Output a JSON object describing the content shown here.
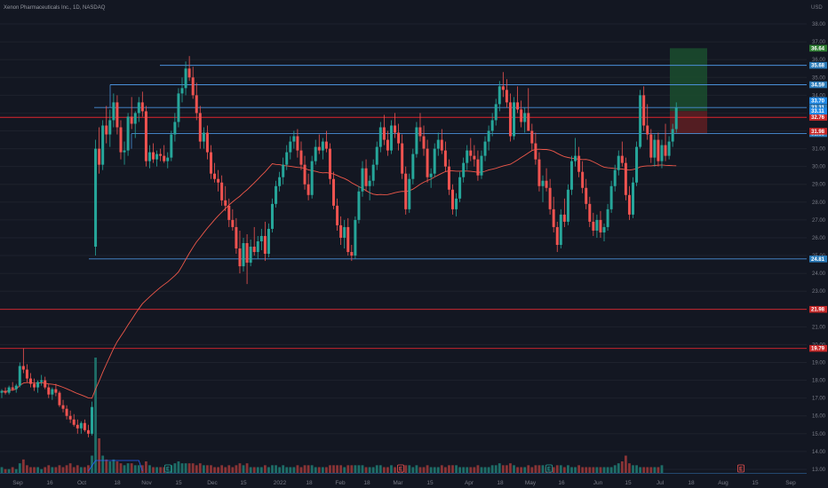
{
  "title": "Xenon Pharmaceuticals Inc., 1D, NASDAQ",
  "currency": "USD",
  "colors": {
    "background": "#131722",
    "up": "#26a69a",
    "down": "#ef5350",
    "blue_line": "#2962ff",
    "light_blue": "#4a90d9",
    "red_line": "#e0262e",
    "ma": "#f0584a",
    "profit_zone": "#1b4d2e",
    "loss_zone": "#5b1e22",
    "axis_text": "#787b86"
  },
  "chart_data": {
    "type": "candlestick",
    "y_axis": {
      "ylim": [
        12.6,
        38.6
      ],
      "ticks": [
        "13.00",
        "14.00",
        "15.00",
        "16.00",
        "17.00",
        "18.00",
        "19.00",
        "20.00",
        "21.00",
        "22.00",
        "23.00",
        "24.00",
        "25.00",
        "26.00",
        "27.00",
        "28.00",
        "29.00",
        "30.00",
        "31.00",
        "32.00",
        "33.00",
        "34.00",
        "35.00",
        "36.00",
        "37.00",
        "38.00"
      ]
    },
    "x_axis": {
      "labels": [
        "Sep",
        "16",
        "Oct",
        "18",
        "Nov",
        "15",
        "Dec",
        "15",
        "2022",
        "18",
        "Feb",
        "18",
        "Mar",
        "15",
        "Apr",
        "18",
        "May",
        "16",
        "Jun",
        "15",
        "Jul",
        "18",
        "Aug",
        "15",
        "Sep"
      ]
    },
    "horizontal_levels": [
      {
        "name": "level-35-68",
        "value": 35.68,
        "color": "light_blue",
        "label": "35.68"
      },
      {
        "name": "level-34-59",
        "value": 34.59,
        "color": "light_blue",
        "label": "34.59"
      },
      {
        "name": "level-33-31",
        "value": 33.31,
        "color": "light_blue",
        "label": "33.31"
      },
      {
        "name": "level-31-85",
        "value": 31.85,
        "color": "light_blue",
        "label": "31.85"
      },
      {
        "name": "level-24-81",
        "value": 24.81,
        "color": "light_blue",
        "label": "24.81"
      },
      {
        "name": "level-32-76",
        "value": 32.76,
        "color": "red_line",
        "label": "32.76"
      },
      {
        "name": "level-21-98",
        "value": 21.98,
        "color": "red_line",
        "label": "21.98"
      },
      {
        "name": "level-19-79",
        "value": 19.79,
        "color": "red_line",
        "label": "19.79"
      }
    ],
    "price_badges": [
      {
        "value": 36.64,
        "label": "36.64",
        "bg": "#2e7d32"
      },
      {
        "value": 33.7,
        "label": "33.70",
        "bg": "#1e88e5"
      },
      {
        "value": 33.11,
        "label": "33.11",
        "bg": "#1e88e5"
      },
      {
        "value": 31.98,
        "label": "31.98",
        "bg": "#c62828"
      }
    ],
    "position": {
      "entry": 33.11,
      "target": 36.64,
      "stop": 31.85
    },
    "candles": [
      [
        17.3,
        17.5,
        17.0,
        17.4
      ],
      [
        17.4,
        17.6,
        17.2,
        17.3
      ],
      [
        17.3,
        17.7,
        17.2,
        17.6
      ],
      [
        17.6,
        17.9,
        17.4,
        17.5
      ],
      [
        17.5,
        17.8,
        17.3,
        17.7
      ],
      [
        17.7,
        19.0,
        17.6,
        18.8
      ],
      [
        18.8,
        19.8,
        18.4,
        18.6
      ],
      [
        18.6,
        18.9,
        17.9,
        18.1
      ],
      [
        18.1,
        18.4,
        17.6,
        17.8
      ],
      [
        17.8,
        18.1,
        17.4,
        17.6
      ],
      [
        17.6,
        18.0,
        17.3,
        17.9
      ],
      [
        17.9,
        18.3,
        17.7,
        18.0
      ],
      [
        18.0,
        18.2,
        17.5,
        17.6
      ],
      [
        17.6,
        17.8,
        17.0,
        17.2
      ],
      [
        17.2,
        17.6,
        16.9,
        17.5
      ],
      [
        17.5,
        17.8,
        17.1,
        17.3
      ],
      [
        17.3,
        17.4,
        16.5,
        16.6
      ],
      [
        16.6,
        16.9,
        16.2,
        16.4
      ],
      [
        16.4,
        16.6,
        15.8,
        16.0
      ],
      [
        16.0,
        16.3,
        15.6,
        15.8
      ],
      [
        15.8,
        16.1,
        15.4,
        15.5
      ],
      [
        15.5,
        15.8,
        15.0,
        15.3
      ],
      [
        15.3,
        15.7,
        15.0,
        15.6
      ],
      [
        15.6,
        15.8,
        15.1,
        15.2
      ],
      [
        15.2,
        15.5,
        14.8,
        15.0
      ],
      [
        15.0,
        16.8,
        14.9,
        16.5
      ],
      [
        25.5,
        31.5,
        25.0,
        31.0
      ],
      [
        31.0,
        32.2,
        29.6,
        30.1
      ],
      [
        30.1,
        32.6,
        29.8,
        32.3
      ],
      [
        32.3,
        33.4,
        31.3,
        31.8
      ],
      [
        31.8,
        33.2,
        31.1,
        32.6
      ],
      [
        32.6,
        34.1,
        32.2,
        33.6
      ],
      [
        33.6,
        34.0,
        31.8,
        32.2
      ],
      [
        32.2,
        32.6,
        30.4,
        30.8
      ],
      [
        30.8,
        31.4,
        30.1,
        30.9
      ],
      [
        30.9,
        33.0,
        30.6,
        32.8
      ],
      [
        32.8,
        33.9,
        32.1,
        32.4
      ],
      [
        32.4,
        33.1,
        31.6,
        33.0
      ],
      [
        33.0,
        33.9,
        32.5,
        33.6
      ],
      [
        33.6,
        34.2,
        32.8,
        33.1
      ],
      [
        33.1,
        33.4,
        30.0,
        30.3
      ],
      [
        30.3,
        31.2,
        29.9,
        30.8
      ],
      [
        30.8,
        31.3,
        30.2,
        30.4
      ],
      [
        30.4,
        30.9,
        30.0,
        30.7
      ],
      [
        30.7,
        31.0,
        30.3,
        30.6
      ],
      [
        30.6,
        31.2,
        30.2,
        30.3
      ],
      [
        30.3,
        30.8,
        29.9,
        30.5
      ],
      [
        30.5,
        32.0,
        30.3,
        31.8
      ],
      [
        31.8,
        33.0,
        31.4,
        32.5
      ],
      [
        32.5,
        34.4,
        32.2,
        34.1
      ],
      [
        34.1,
        35.0,
        33.6,
        34.4
      ],
      [
        34.4,
        35.9,
        34.0,
        35.5
      ],
      [
        35.5,
        36.2,
        34.8,
        35.0
      ],
      [
        35.0,
        35.6,
        33.8,
        34.0
      ],
      [
        34.0,
        34.7,
        32.6,
        33.0
      ],
      [
        33.0,
        33.4,
        31.0,
        31.4
      ],
      [
        31.4,
        32.2,
        31.0,
        31.9
      ],
      [
        31.9,
        32.3,
        30.4,
        30.8
      ],
      [
        30.8,
        31.2,
        29.3,
        29.6
      ],
      [
        29.6,
        30.2,
        29.1,
        29.3
      ],
      [
        29.3,
        29.8,
        28.6,
        29.1
      ],
      [
        29.1,
        29.5,
        27.8,
        28.1
      ],
      [
        28.1,
        28.9,
        27.5,
        27.8
      ],
      [
        27.8,
        28.2,
        26.6,
        27.0
      ],
      [
        27.0,
        27.6,
        26.4,
        26.6
      ],
      [
        26.6,
        27.1,
        25.1,
        25.4
      ],
      [
        25.4,
        26.4,
        24.0,
        24.4
      ],
      [
        24.4,
        26.0,
        24.1,
        25.7
      ],
      [
        25.7,
        26.2,
        23.4,
        24.6
      ],
      [
        24.6,
        25.9,
        24.4,
        25.5
      ],
      [
        25.5,
        26.6,
        25.0,
        25.2
      ],
      [
        25.2,
        26.1,
        24.8,
        25.8
      ],
      [
        25.8,
        26.5,
        25.3,
        26.1
      ],
      [
        26.1,
        26.9,
        24.7,
        25.1
      ],
      [
        25.1,
        26.8,
        24.9,
        26.5
      ],
      [
        26.5,
        28.2,
        26.3,
        27.9
      ],
      [
        27.9,
        29.2,
        27.7,
        28.9
      ],
      [
        28.9,
        29.7,
        28.6,
        29.4
      ],
      [
        29.4,
        30.5,
        29.0,
        30.1
      ],
      [
        30.1,
        31.2,
        29.8,
        30.8
      ],
      [
        30.8,
        31.7,
        30.4,
        31.4
      ],
      [
        31.4,
        32.0,
        31.0,
        31.7
      ],
      [
        31.7,
        32.1,
        30.5,
        30.9
      ],
      [
        30.9,
        31.4,
        29.8,
        30.1
      ],
      [
        30.1,
        30.6,
        28.7,
        29.0
      ],
      [
        29.0,
        29.6,
        28.1,
        28.4
      ],
      [
        28.4,
        30.6,
        28.2,
        30.3
      ],
      [
        30.3,
        31.5,
        30.1,
        31.1
      ],
      [
        31.1,
        31.8,
        30.7,
        30.9
      ],
      [
        30.9,
        31.6,
        30.4,
        31.4
      ],
      [
        31.4,
        32.0,
        30.8,
        31.0
      ],
      [
        31.0,
        31.3,
        29.0,
        29.3
      ],
      [
        29.3,
        29.7,
        27.6,
        27.8
      ],
      [
        27.8,
        28.2,
        26.4,
        26.7
      ],
      [
        26.7,
        27.2,
        25.6,
        26.0
      ],
      [
        26.0,
        27.0,
        25.4,
        26.6
      ],
      [
        26.6,
        27.1,
        25.0,
        25.2
      ],
      [
        25.2,
        25.6,
        24.7,
        25.0
      ],
      [
        25.0,
        27.2,
        24.8,
        27.0
      ],
      [
        27.0,
        28.9,
        26.8,
        28.6
      ],
      [
        28.6,
        30.3,
        28.3,
        29.9
      ],
      [
        29.9,
        30.4,
        28.6,
        28.9
      ],
      [
        28.9,
        29.5,
        28.1,
        29.2
      ],
      [
        29.2,
        30.4,
        28.9,
        30.1
      ],
      [
        30.1,
        31.4,
        29.8,
        31.1
      ],
      [
        31.1,
        32.5,
        30.8,
        32.2
      ],
      [
        32.2,
        32.9,
        31.2,
        31.5
      ],
      [
        31.5,
        32.0,
        30.6,
        30.9
      ],
      [
        30.9,
        32.6,
        30.7,
        32.3
      ],
      [
        32.3,
        33.0,
        31.6,
        31.9
      ],
      [
        31.9,
        32.4,
        30.9,
        31.3
      ],
      [
        31.3,
        31.8,
        29.3,
        29.6
      ],
      [
        29.6,
        30.0,
        27.3,
        27.6
      ],
      [
        27.6,
        29.6,
        27.4,
        29.3
      ],
      [
        29.3,
        31.0,
        29.0,
        30.7
      ],
      [
        30.7,
        32.5,
        30.5,
        32.2
      ],
      [
        32.2,
        33.0,
        31.4,
        31.7
      ],
      [
        31.7,
        32.3,
        30.6,
        31.0
      ],
      [
        31.0,
        31.5,
        29.1,
        29.4
      ],
      [
        29.4,
        29.9,
        28.8,
        29.6
      ],
      [
        29.6,
        31.3,
        29.4,
        31.0
      ],
      [
        31.0,
        31.9,
        30.6,
        31.5
      ],
      [
        31.5,
        32.1,
        30.7,
        30.9
      ],
      [
        30.9,
        31.4,
        29.7,
        30.0
      ],
      [
        30.0,
        30.4,
        28.4,
        28.7
      ],
      [
        28.7,
        29.0,
        27.3,
        27.6
      ],
      [
        27.6,
        28.5,
        27.2,
        28.2
      ],
      [
        28.2,
        29.7,
        28.0,
        29.4
      ],
      [
        29.4,
        30.5,
        29.1,
        30.2
      ],
      [
        30.2,
        31.2,
        29.8,
        30.9
      ],
      [
        30.9,
        31.6,
        30.3,
        30.6
      ],
      [
        30.6,
        31.2,
        30.0,
        30.4
      ],
      [
        30.4,
        30.9,
        29.2,
        29.5
      ],
      [
        29.5,
        30.9,
        29.3,
        30.6
      ],
      [
        30.6,
        31.7,
        30.3,
        31.4
      ],
      [
        31.4,
        32.3,
        30.9,
        32.0
      ],
      [
        32.0,
        33.0,
        31.7,
        32.6
      ],
      [
        32.6,
        33.8,
        32.3,
        33.5
      ],
      [
        33.5,
        34.8,
        33.1,
        34.5
      ],
      [
        34.5,
        35.3,
        33.9,
        34.3
      ],
      [
        34.3,
        34.9,
        33.3,
        33.6
      ],
      [
        33.6,
        34.1,
        31.4,
        31.7
      ],
      [
        31.7,
        33.9,
        31.5,
        33.6
      ],
      [
        33.6,
        34.5,
        33.0,
        33.2
      ],
      [
        33.2,
        33.7,
        32.2,
        32.5
      ],
      [
        32.5,
        33.3,
        31.9,
        33.0
      ],
      [
        33.0,
        34.4,
        32.7,
        32.0
      ],
      [
        32.0,
        32.4,
        30.9,
        31.3
      ],
      [
        31.3,
        31.9,
        30.1,
        30.4
      ],
      [
        30.4,
        30.8,
        28.6,
        28.9
      ],
      [
        28.9,
        29.5,
        28.0,
        29.2
      ],
      [
        29.2,
        29.9,
        28.6,
        28.8
      ],
      [
        28.8,
        29.3,
        27.3,
        27.6
      ],
      [
        27.6,
        28.3,
        26.3,
        26.6
      ],
      [
        26.6,
        26.9,
        25.2,
        25.6
      ],
      [
        25.6,
        27.6,
        25.4,
        27.3
      ],
      [
        27.3,
        28.2,
        26.6,
        26.9
      ],
      [
        26.9,
        29.0,
        26.7,
        28.7
      ],
      [
        28.7,
        30.6,
        28.4,
        30.3
      ],
      [
        30.3,
        31.6,
        30.0,
        30.6
      ],
      [
        30.6,
        31.1,
        29.4,
        29.7
      ],
      [
        29.7,
        30.3,
        28.5,
        28.8
      ],
      [
        28.8,
        29.3,
        27.6,
        27.9
      ],
      [
        27.9,
        28.3,
        26.6,
        26.9
      ],
      [
        26.9,
        27.4,
        26.1,
        26.4
      ],
      [
        26.4,
        27.3,
        26.0,
        27.0
      ],
      [
        27.0,
        27.5,
        26.0,
        26.3
      ],
      [
        26.3,
        26.8,
        25.8,
        26.6
      ],
      [
        26.6,
        27.9,
        26.4,
        27.6
      ],
      [
        27.6,
        29.2,
        27.4,
        28.9
      ],
      [
        28.9,
        30.1,
        28.6,
        29.8
      ],
      [
        29.8,
        30.9,
        29.5,
        30.6
      ],
      [
        30.6,
        31.4,
        30.0,
        30.2
      ],
      [
        30.2,
        30.5,
        28.1,
        28.4
      ],
      [
        28.4,
        28.9,
        27.0,
        27.3
      ],
      [
        27.3,
        29.4,
        27.1,
        29.1
      ],
      [
        29.1,
        31.4,
        28.9,
        31.1
      ],
      [
        31.1,
        34.3,
        31.0,
        34.0
      ],
      [
        34.0,
        34.5,
        32.0,
        32.3
      ],
      [
        32.3,
        33.5,
        31.5,
        31.8
      ],
      [
        31.8,
        32.1,
        30.2,
        30.5
      ],
      [
        30.5,
        31.8,
        30.0,
        31.5
      ],
      [
        31.5,
        31.9,
        30.0,
        30.3
      ],
      [
        30.3,
        31.5,
        29.9,
        31.2
      ],
      [
        31.2,
        32.4,
        30.3,
        30.6
      ],
      [
        30.6,
        31.7,
        30.4,
        31.4
      ],
      [
        31.4,
        32.4,
        31.1,
        32.1
      ],
      [
        32.1,
        33.6,
        31.9,
        33.3
      ]
    ],
    "volumes": [
      3,
      2,
      2,
      3,
      2,
      5,
      7,
      4,
      3,
      3,
      3,
      2,
      3,
      4,
      3,
      3,
      4,
      3,
      4,
      5,
      3,
      4,
      3,
      3,
      4,
      9,
      60,
      18,
      9,
      7,
      6,
      7,
      6,
      5,
      4,
      5,
      5,
      4,
      4,
      4,
      6,
      4,
      3,
      3,
      3,
      3,
      3,
      4,
      5,
      6,
      5,
      5,
      5,
      5,
      4,
      5,
      4,
      4,
      4,
      3,
      3,
      4,
      3,
      4,
      3,
      4,
      5,
      4,
      5,
      3,
      3,
      3,
      3,
      4,
      3,
      4,
      4,
      3,
      4,
      3,
      3,
      3,
      4,
      3,
      4,
      4,
      4,
      3,
      3,
      3,
      3,
      4,
      4,
      4,
      4,
      3,
      4,
      4,
      4,
      4,
      4,
      3,
      3,
      3,
      4,
      4,
      3,
      3,
      4,
      3,
      3,
      4,
      4,
      4,
      3,
      4,
      3,
      3,
      4,
      3,
      3,
      3,
      4,
      3,
      4,
      4,
      4,
      3,
      3,
      3,
      3,
      3,
      4,
      3,
      3,
      3,
      4,
      4,
      5,
      4,
      4,
      5,
      4,
      3,
      3,
      3,
      4,
      3,
      4,
      4,
      4,
      3,
      4,
      3,
      4,
      4,
      3,
      4,
      3,
      3,
      4,
      3,
      3,
      3,
      3,
      3,
      3,
      3,
      3,
      3,
      4,
      5,
      6,
      9,
      5,
      4,
      4,
      3,
      3,
      3,
      3,
      3,
      3,
      4
    ],
    "avg_volume_line": {
      "start": 26,
      "end": 38,
      "level": 14
    },
    "event_markers": [
      {
        "label": "E",
        "x": "18 Nov-ish",
        "kind": "earnings"
      },
      {
        "label": "E",
        "x": "Mar",
        "kind": "earnings"
      },
      {
        "label": "E",
        "x": "Jun",
        "kind": "earnings"
      },
      {
        "label": "E",
        "x": "Aug",
        "kind": "earnings"
      }
    ]
  }
}
